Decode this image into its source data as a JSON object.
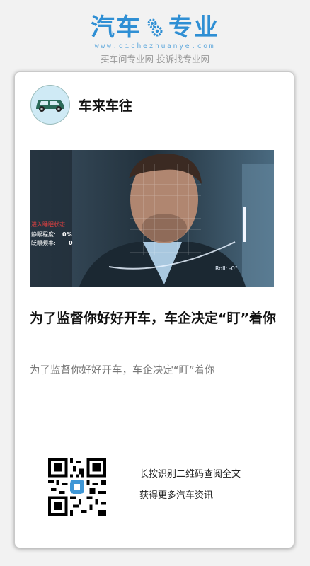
{
  "brand": {
    "word_left": "汽车",
    "word_right": "专业",
    "url": "www.qichezhuanye.com",
    "slogan": "买车问专业网 投诉找专业网",
    "gear_icon": "gear-icon",
    "color": "#2f8fd4"
  },
  "author": {
    "name": "车来车往",
    "avatar_icon": "car-icon"
  },
  "article": {
    "title": "为了监督你好好开车，车企决定“盯”着你",
    "summary": "为了监督你好好开车，车企决定“盯”着你"
  },
  "hero_overlay": {
    "status": "进入睡眠状态",
    "closed_eye_label": "静眼程度:",
    "closed_eye_value": "0%",
    "blink_label": "眨眼频率:",
    "blink_value": "0",
    "roll_label": "Roll: -0°"
  },
  "qr": {
    "line1": "长按识别二维码查阅全文",
    "line2": "获得更多汽车资讯",
    "icon": "qr-code-icon"
  }
}
